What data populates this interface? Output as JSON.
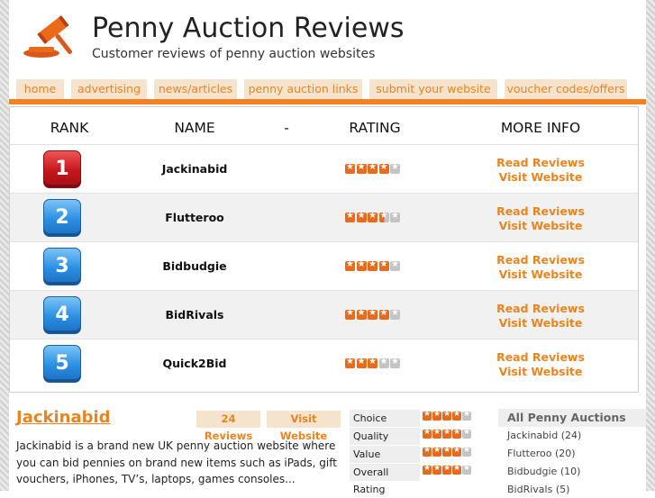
{
  "header": {
    "title": "Penny Auction Reviews",
    "subtitle": "Customer reviews of penny auction websites"
  },
  "nav": [
    "home",
    "advertising",
    "news/articles",
    "penny auction links",
    "submit your website",
    "voucher codes/offers"
  ],
  "table": {
    "headers": [
      "RANK",
      "NAME",
      "-",
      "RATING",
      "MORE INFO"
    ],
    "rows": [
      {
        "rank": "1",
        "name": "Jackinabid",
        "rating": 4,
        "read": "Read Reviews",
        "visit": "Visit Website"
      },
      {
        "rank": "2",
        "name": "Flutteroo",
        "rating": 3.5,
        "read": "Read Reviews",
        "visit": "Visit Website"
      },
      {
        "rank": "3",
        "name": "Bidbudgie",
        "rating": 4,
        "read": "Read Reviews",
        "visit": "Visit Website"
      },
      {
        "rank": "4",
        "name": "BidRivals",
        "rating": 4,
        "read": "Read Reviews",
        "visit": "Visit Website"
      },
      {
        "rank": "5",
        "name": "Quick2Bid",
        "rating": 3,
        "read": "Read Reviews",
        "visit": "Visit Website"
      }
    ]
  },
  "featured": {
    "name": "Jackinabid",
    "reviews_link": "24 Reviews",
    "visit_link": "Visit Website",
    "description": "Jackinabid is a brand new UK penny auction website where you can bid pennies on brand new items such as iPads, gift vouchers, iPhones, TV’s, laptops, games consoles...",
    "scores": [
      {
        "label": "Choice",
        "rating": 4
      },
      {
        "label": "Quality",
        "rating": 4
      },
      {
        "label": "Value",
        "rating": 4
      },
      {
        "label": "Overall Rating",
        "rating": 4
      }
    ]
  },
  "all_auctions": {
    "title": "All Penny Auctions",
    "items": [
      "Jackinabid (24)",
      "Flutteroo (20)",
      "Bidbudgie (10)",
      "BidRivals (5)"
    ]
  },
  "colors": {
    "accent": "#f08224",
    "link": "#e98521",
    "tab_bg": "#f5e3cd",
    "rank1": "#c4161c",
    "rank_other": "#2a8ee3"
  }
}
